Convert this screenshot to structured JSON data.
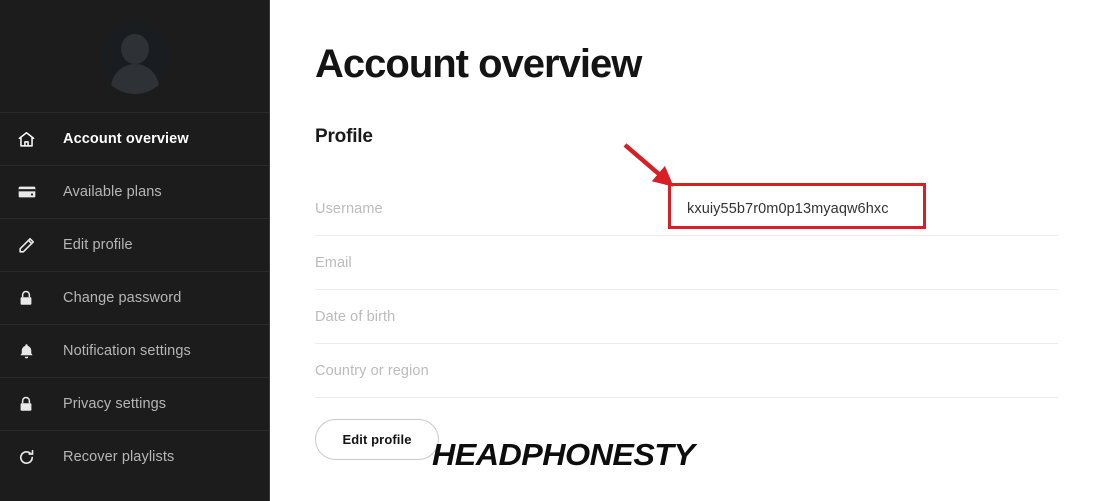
{
  "sidebar": {
    "avatar": {
      "name": "user-avatar",
      "alt": "Profile picture placeholder"
    },
    "items": [
      {
        "label": "Account overview",
        "icon": "home-icon",
        "active": true
      },
      {
        "label": "Available plans",
        "icon": "credit-card-icon",
        "active": false
      },
      {
        "label": "Edit profile",
        "icon": "pencil-icon",
        "active": false
      },
      {
        "label": "Change password",
        "icon": "lock-icon",
        "active": false
      },
      {
        "label": "Notification settings",
        "icon": "bell-icon",
        "active": false
      },
      {
        "label": "Privacy settings",
        "icon": "lock-icon",
        "active": false
      },
      {
        "label": "Recover playlists",
        "icon": "refresh-icon",
        "active": false
      }
    ]
  },
  "main": {
    "page_title": "Account overview",
    "section_title": "Profile",
    "fields": [
      {
        "label": "Username",
        "value": "kxuiy55b7r0m0p13myaqw6hxc"
      },
      {
        "label": "Email",
        "value": ""
      },
      {
        "label": "Date of birth",
        "value": ""
      },
      {
        "label": "Country or region",
        "value": ""
      }
    ],
    "edit_profile_button": "Edit profile",
    "watermark": "HEADPHONESTY"
  },
  "annotation": {
    "highlight_color": "#d81f26",
    "arrow_color": "#d81f26",
    "target": "username-value"
  },
  "colors": {
    "sidebar_bg": "#1c1c1c",
    "sidebar_divider": "#2b2b2b",
    "content_bg": "#ffffff",
    "label_text": "#bbbbbb",
    "value_text": "#333333",
    "title_text": "#141414",
    "accent_red": "#d81f26"
  }
}
